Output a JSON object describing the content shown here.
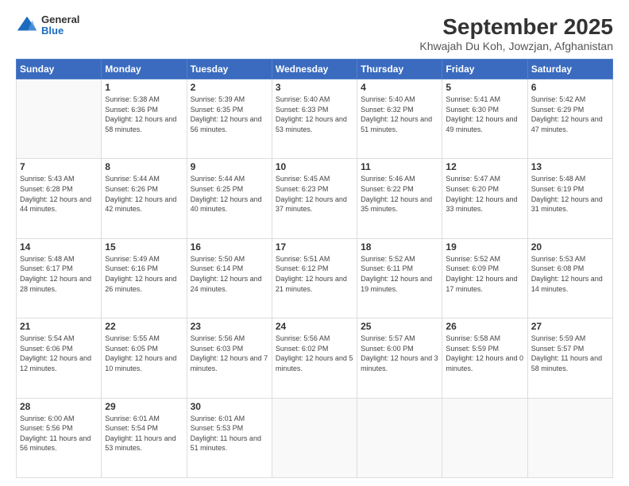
{
  "header": {
    "logo": {
      "general": "General",
      "blue": "Blue"
    },
    "title": "September 2025",
    "subtitle": "Khwajah Du Koh, Jowzjan, Afghanistan"
  },
  "weekdays": [
    "Sunday",
    "Monday",
    "Tuesday",
    "Wednesday",
    "Thursday",
    "Friday",
    "Saturday"
  ],
  "weeks": [
    [
      {
        "day": "",
        "empty": true
      },
      {
        "day": "1",
        "sunrise": "Sunrise: 5:38 AM",
        "sunset": "Sunset: 6:36 PM",
        "daylight": "Daylight: 12 hours and 58 minutes."
      },
      {
        "day": "2",
        "sunrise": "Sunrise: 5:39 AM",
        "sunset": "Sunset: 6:35 PM",
        "daylight": "Daylight: 12 hours and 56 minutes."
      },
      {
        "day": "3",
        "sunrise": "Sunrise: 5:40 AM",
        "sunset": "Sunset: 6:33 PM",
        "daylight": "Daylight: 12 hours and 53 minutes."
      },
      {
        "day": "4",
        "sunrise": "Sunrise: 5:40 AM",
        "sunset": "Sunset: 6:32 PM",
        "daylight": "Daylight: 12 hours and 51 minutes."
      },
      {
        "day": "5",
        "sunrise": "Sunrise: 5:41 AM",
        "sunset": "Sunset: 6:30 PM",
        "daylight": "Daylight: 12 hours and 49 minutes."
      },
      {
        "day": "6",
        "sunrise": "Sunrise: 5:42 AM",
        "sunset": "Sunset: 6:29 PM",
        "daylight": "Daylight: 12 hours and 47 minutes."
      }
    ],
    [
      {
        "day": "7",
        "sunrise": "Sunrise: 5:43 AM",
        "sunset": "Sunset: 6:28 PM",
        "daylight": "Daylight: 12 hours and 44 minutes."
      },
      {
        "day": "8",
        "sunrise": "Sunrise: 5:44 AM",
        "sunset": "Sunset: 6:26 PM",
        "daylight": "Daylight: 12 hours and 42 minutes."
      },
      {
        "day": "9",
        "sunrise": "Sunrise: 5:44 AM",
        "sunset": "Sunset: 6:25 PM",
        "daylight": "Daylight: 12 hours and 40 minutes."
      },
      {
        "day": "10",
        "sunrise": "Sunrise: 5:45 AM",
        "sunset": "Sunset: 6:23 PM",
        "daylight": "Daylight: 12 hours and 37 minutes."
      },
      {
        "day": "11",
        "sunrise": "Sunrise: 5:46 AM",
        "sunset": "Sunset: 6:22 PM",
        "daylight": "Daylight: 12 hours and 35 minutes."
      },
      {
        "day": "12",
        "sunrise": "Sunrise: 5:47 AM",
        "sunset": "Sunset: 6:20 PM",
        "daylight": "Daylight: 12 hours and 33 minutes."
      },
      {
        "day": "13",
        "sunrise": "Sunrise: 5:48 AM",
        "sunset": "Sunset: 6:19 PM",
        "daylight": "Daylight: 12 hours and 31 minutes."
      }
    ],
    [
      {
        "day": "14",
        "sunrise": "Sunrise: 5:48 AM",
        "sunset": "Sunset: 6:17 PM",
        "daylight": "Daylight: 12 hours and 28 minutes."
      },
      {
        "day": "15",
        "sunrise": "Sunrise: 5:49 AM",
        "sunset": "Sunset: 6:16 PM",
        "daylight": "Daylight: 12 hours and 26 minutes."
      },
      {
        "day": "16",
        "sunrise": "Sunrise: 5:50 AM",
        "sunset": "Sunset: 6:14 PM",
        "daylight": "Daylight: 12 hours and 24 minutes."
      },
      {
        "day": "17",
        "sunrise": "Sunrise: 5:51 AM",
        "sunset": "Sunset: 6:12 PM",
        "daylight": "Daylight: 12 hours and 21 minutes."
      },
      {
        "day": "18",
        "sunrise": "Sunrise: 5:52 AM",
        "sunset": "Sunset: 6:11 PM",
        "daylight": "Daylight: 12 hours and 19 minutes."
      },
      {
        "day": "19",
        "sunrise": "Sunrise: 5:52 AM",
        "sunset": "Sunset: 6:09 PM",
        "daylight": "Daylight: 12 hours and 17 minutes."
      },
      {
        "day": "20",
        "sunrise": "Sunrise: 5:53 AM",
        "sunset": "Sunset: 6:08 PM",
        "daylight": "Daylight: 12 hours and 14 minutes."
      }
    ],
    [
      {
        "day": "21",
        "sunrise": "Sunrise: 5:54 AM",
        "sunset": "Sunset: 6:06 PM",
        "daylight": "Daylight: 12 hours and 12 minutes."
      },
      {
        "day": "22",
        "sunrise": "Sunrise: 5:55 AM",
        "sunset": "Sunset: 6:05 PM",
        "daylight": "Daylight: 12 hours and 10 minutes."
      },
      {
        "day": "23",
        "sunrise": "Sunrise: 5:56 AM",
        "sunset": "Sunset: 6:03 PM",
        "daylight": "Daylight: 12 hours and 7 minutes."
      },
      {
        "day": "24",
        "sunrise": "Sunrise: 5:56 AM",
        "sunset": "Sunset: 6:02 PM",
        "daylight": "Daylight: 12 hours and 5 minutes."
      },
      {
        "day": "25",
        "sunrise": "Sunrise: 5:57 AM",
        "sunset": "Sunset: 6:00 PM",
        "daylight": "Daylight: 12 hours and 3 minutes."
      },
      {
        "day": "26",
        "sunrise": "Sunrise: 5:58 AM",
        "sunset": "Sunset: 5:59 PM",
        "daylight": "Daylight: 12 hours and 0 minutes."
      },
      {
        "day": "27",
        "sunrise": "Sunrise: 5:59 AM",
        "sunset": "Sunset: 5:57 PM",
        "daylight": "Daylight: 11 hours and 58 minutes."
      }
    ],
    [
      {
        "day": "28",
        "sunrise": "Sunrise: 6:00 AM",
        "sunset": "Sunset: 5:56 PM",
        "daylight": "Daylight: 11 hours and 56 minutes."
      },
      {
        "day": "29",
        "sunrise": "Sunrise: 6:01 AM",
        "sunset": "Sunset: 5:54 PM",
        "daylight": "Daylight: 11 hours and 53 minutes."
      },
      {
        "day": "30",
        "sunrise": "Sunrise: 6:01 AM",
        "sunset": "Sunset: 5:53 PM",
        "daylight": "Daylight: 11 hours and 51 minutes."
      },
      {
        "day": "",
        "empty": true
      },
      {
        "day": "",
        "empty": true
      },
      {
        "day": "",
        "empty": true
      },
      {
        "day": "",
        "empty": true
      }
    ]
  ]
}
